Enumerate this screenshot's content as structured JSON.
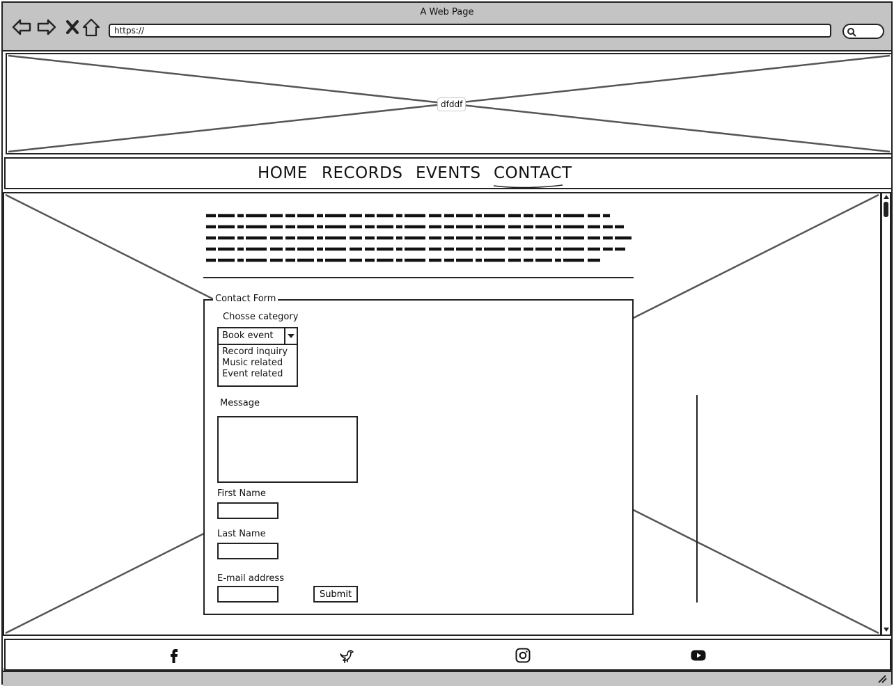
{
  "window": {
    "title": "A Web Page"
  },
  "address_bar": {
    "url": "https://"
  },
  "hero": {
    "label": "dfddf"
  },
  "nav": {
    "items": [
      {
        "label": "HOME"
      },
      {
        "label": "RECORDS"
      },
      {
        "label": "EVENTS"
      },
      {
        "label": "CONTACT",
        "active": true
      }
    ]
  },
  "form": {
    "legend": "Contact Form",
    "category_label": "Chosse category",
    "category_selected": "Book event",
    "category_options": [
      "Record inquiry",
      "Music related",
      "Event related"
    ],
    "message_label": "Message",
    "first_name_label": "First Name",
    "last_name_label": "Last Name",
    "email_label": "E-mail address",
    "submit_label": "Submit"
  },
  "footer": {
    "icons": [
      "facebook-icon",
      "twitter-icon",
      "instagram-icon",
      "youtube-icon"
    ]
  }
}
